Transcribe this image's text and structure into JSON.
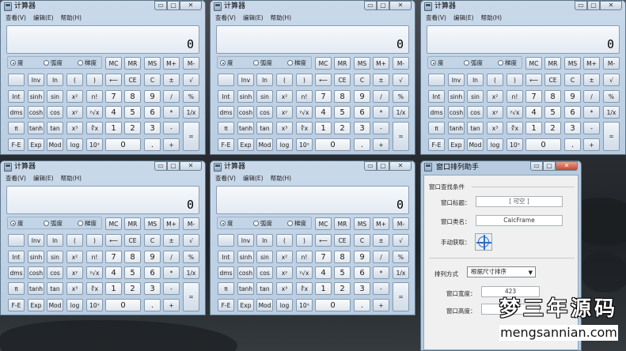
{
  "calculator": {
    "title": "计算器",
    "window_buttons": [
      "▭",
      "▢",
      "✕"
    ],
    "menu": [
      "查看(V)",
      "编辑(E)",
      "帮助(H)"
    ],
    "display_value": "0",
    "angle_modes": [
      "度",
      "弧度",
      "梯度"
    ],
    "selected_angle_mode": "度",
    "keys": [
      [
        " ",
        "Inv",
        "ln",
        "(",
        ")",
        "⟵",
        "CE",
        "C",
        "±",
        "√"
      ],
      [
        "Int",
        "sinh",
        "sin",
        "x²",
        "n!",
        "7",
        "8",
        "9",
        "/",
        "%"
      ],
      [
        "dms",
        "cosh",
        "cos",
        "xʸ",
        "ʸ√x",
        "4",
        "5",
        "6",
        "*",
        "1/x"
      ],
      [
        "π",
        "tanh",
        "tan",
        "x³",
        "∛x",
        "1",
        "2",
        "3",
        "-",
        "="
      ],
      [
        "F-E",
        "Exp",
        "Mod",
        "log",
        "10ˣ",
        "0",
        "",
        ".",
        "+",
        ""
      ]
    ],
    "memory_keys": [
      "MC",
      "MR",
      "MS",
      "M+",
      "M-"
    ]
  },
  "helper": {
    "title": "窗口排列助手",
    "window_buttons": [
      "▭",
      "▢",
      "✕"
    ],
    "group_find": "窗口查找条件",
    "label_window_title": "窗口标题：",
    "window_title_value": "[ 可空 ]",
    "label_class_name": "窗口类名：",
    "class_name_value": "CalcFrame",
    "label_manual": "手动获取：",
    "label_arrange": "排列方式",
    "arrange_value": "根据尺寸排序",
    "label_width": "窗口宽度：",
    "width_value": "423",
    "label_height": "窗口高度：",
    "height_value": ""
  },
  "watermark": {
    "top": "梦三年源码",
    "bottom": "mengsannian.com"
  }
}
